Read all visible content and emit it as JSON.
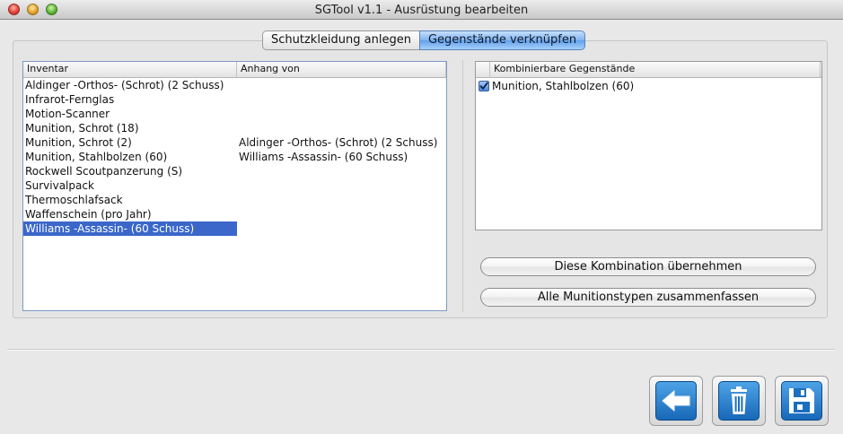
{
  "window": {
    "title": "SGTool v1.1 - Ausrüstung bearbeiten"
  },
  "tabs": [
    {
      "label": "Schutzkleidung anlegen",
      "active": false
    },
    {
      "label": "Gegenstände verknüpfen",
      "active": true
    }
  ],
  "inventory": {
    "headers": [
      "Inventar",
      "Anhang von"
    ],
    "rows": [
      {
        "item": "Aldinger -Orthos- (Schrot) (2 Schuss)",
        "attached": ""
      },
      {
        "item": "Infrarot-Fernglas",
        "attached": ""
      },
      {
        "item": "Motion-Scanner",
        "attached": ""
      },
      {
        "item": "Munition, Schrot (18)",
        "attached": ""
      },
      {
        "item": "Munition, Schrot (2)",
        "attached": "Aldinger -Orthos- (Schrot) (2 Schuss)"
      },
      {
        "item": "Munition, Stahlbolzen (60)",
        "attached": "Williams -Assassin- (60 Schuss)"
      },
      {
        "item": "Rockwell Scoutpanzerung (S)",
        "attached": ""
      },
      {
        "item": "Survivalpack",
        "attached": ""
      },
      {
        "item": "Thermoschlafsack",
        "attached": ""
      },
      {
        "item": "Waffenschein (pro Jahr)",
        "attached": ""
      },
      {
        "item": "Williams -Assassin- (60 Schuss)",
        "attached": "",
        "selected": true
      }
    ]
  },
  "combinable": {
    "header": "Kombinierbare Gegenstände",
    "rows": [
      {
        "label": "Munition, Stahlbolzen (60)",
        "checked": true
      }
    ]
  },
  "buttons": {
    "apply_combination": "Diese Kombination übernehmen",
    "merge_ammo": "Alle Munitionstypen zusammenfassen"
  },
  "icons": {
    "back": "arrow-left-icon",
    "delete": "trash-icon",
    "save": "floppy-disk-icon"
  },
  "colors": {
    "selection": "#3a67c9",
    "icon_tile": "#1768b8"
  }
}
